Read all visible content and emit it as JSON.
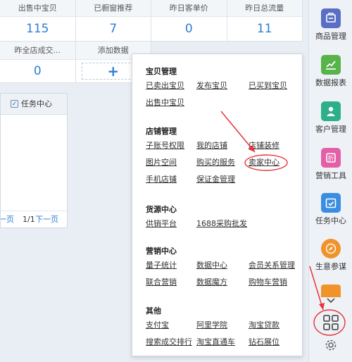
{
  "stats": {
    "row1": [
      {
        "label": "出售中宝贝",
        "value": "115"
      },
      {
        "label": "已橱窗推荐",
        "value": "7"
      },
      {
        "label": "昨日客单价",
        "value": "0"
      },
      {
        "label": "昨日总流量",
        "value": "11"
      }
    ],
    "row2": [
      {
        "label": "昨全店成交...",
        "value": "0"
      },
      {
        "label": "添加数据",
        "plus": "+"
      }
    ]
  },
  "task_panel": {
    "header": "任务中心",
    "pager": {
      "prev": "上一页",
      "page": "1/1",
      "next": "下一页"
    }
  },
  "menu": {
    "sections": [
      {
        "title": "宝贝管理",
        "items": [
          "已卖出宝贝",
          "发布宝贝",
          "已买到宝贝",
          "出售中宝贝"
        ]
      },
      {
        "title": "店铺管理",
        "items": [
          "子账号权限",
          "我的店铺",
          "店铺装修",
          "图片空间",
          "购买的服务",
          "卖家中心",
          "手机店铺",
          "保证金管理"
        ]
      },
      {
        "title": "货源中心",
        "items": [
          "供销平台",
          "1688采购批发"
        ]
      },
      {
        "title": "营销中心",
        "items": [
          "量子统计",
          "数据中心",
          "会员关系管理",
          "联合营销",
          "数据魔方",
          "购物车营销"
        ]
      },
      {
        "title": "其他",
        "items": [
          "支付宝",
          "阿里学院",
          "淘宝贷款",
          "搜索成交排行",
          "淘宝直通车",
          "钻石展位"
        ]
      }
    ]
  },
  "toolbar": {
    "items": [
      {
        "label": "商品管理",
        "color": "#5a6fc4"
      },
      {
        "label": "数据报表",
        "color": "#58b34a"
      },
      {
        "label": "客户管理",
        "color": "#2daf8a"
      },
      {
        "label": "营销工具",
        "color": "#e35fa6"
      },
      {
        "label": "任务中心",
        "color": "#3a8de0"
      },
      {
        "label": "生意参谋",
        "color": "#f0932b"
      }
    ]
  },
  "colors": {
    "accent": "#2c7fd3",
    "annotation": "#e8333a"
  }
}
